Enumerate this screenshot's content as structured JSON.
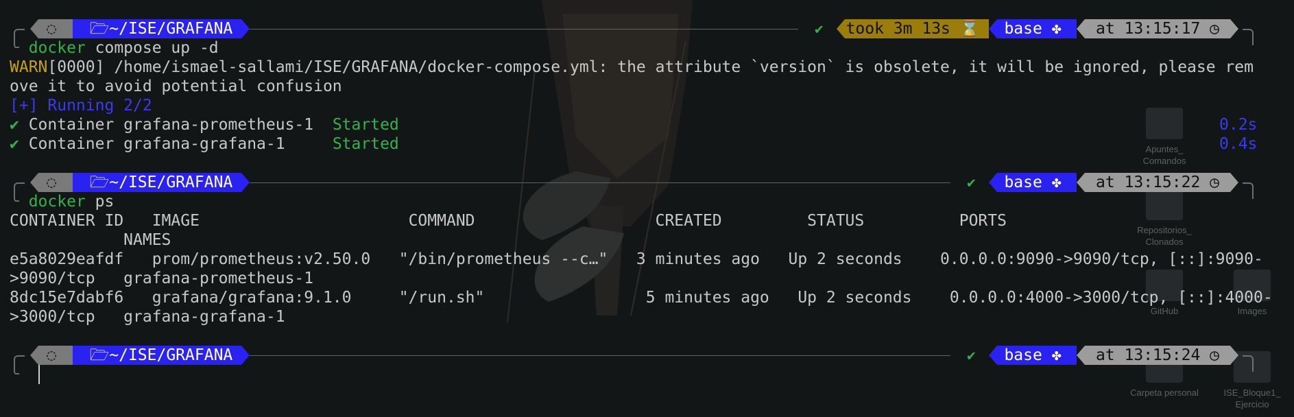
{
  "prompt": {
    "os_icon": "ubuntu-icon",
    "folder_icon": "folder-open-icon",
    "dir": "~/ISE/GRAFANA",
    "env": "base",
    "env_icon": "python-icon",
    "clock_icon": "clock-icon",
    "hourglass_icon": "hourglass-icon",
    "check": "✔"
  },
  "block1": {
    "took": "took 3m 13s",
    "time": "at 13:15:17",
    "cmd_word": "docker",
    "cmd_rest": " compose up -d",
    "warn_label": "WARN",
    "warn_line1": "[0000] /home/ismael-sallami/ISE/GRAFANA/docker-compose.yml: the attribute `version` is obsolete, it will be ignored, please rem",
    "warn_line2": "ove it to avoid potential confusion",
    "running": "[+] Running 2/2",
    "containers": [
      {
        "check": "✔",
        "name": " Container grafana-prometheus-1  ",
        "status": "Started",
        "time": "0.2s"
      },
      {
        "check": "✔",
        "name": " Container grafana-grafana-1     ",
        "status": "Started",
        "time": "0.4s"
      }
    ]
  },
  "block2": {
    "time": "at 13:15:22",
    "cmd_word": "docker",
    "cmd_rest": " ps",
    "header1": "CONTAINER ID   IMAGE                      COMMAND                   CREATED         STATUS          PORTS",
    "header2": "            NAMES",
    "rows": [
      {
        "l1": "e5a8029eafdf   prom/prometheus:v2.50.0   \"/bin/prometheus --c…\"   3 minutes ago   Up 2 seconds    0.0.0.0:9090->9090/tcp, [::]:9090-",
        "l2": ">9090/tcp   grafana-prometheus-1"
      },
      {
        "l1": "8dc15e7dabf6   grafana/grafana:9.1.0     \"/run.sh\"                 5 minutes ago   Up 2 seconds    0.0.0.0:4000->3000/tcp, [::]:4000-",
        "l2": ">3000/tcp   grafana-grafana-1"
      }
    ]
  },
  "block3": {
    "time": "at 13:15:24"
  },
  "desktop": {
    "icons": [
      "Apuntes_\nComandos",
      "Repositorios_\nClonados",
      "GitHub",
      "Images",
      "Carpeta personal",
      "ISE_Bloque1_\nEjercicio"
    ]
  }
}
